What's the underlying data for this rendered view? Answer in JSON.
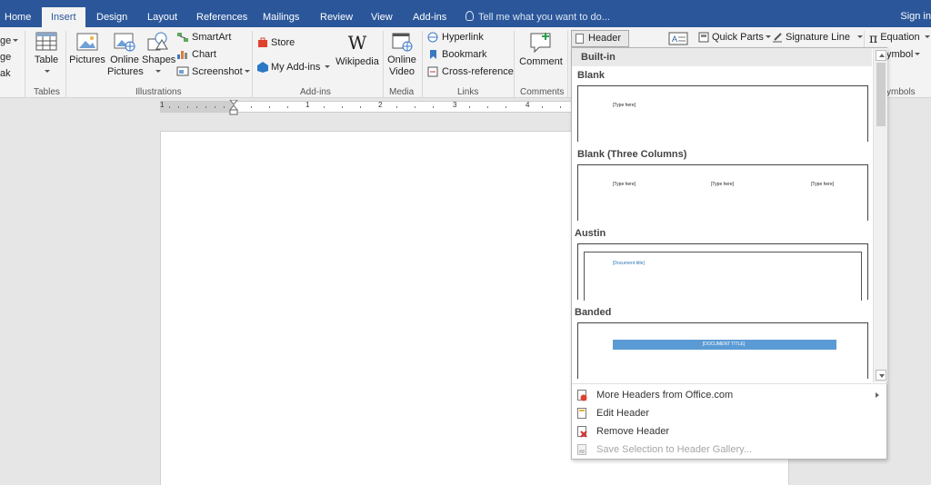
{
  "tabs": [
    {
      "key": "home",
      "label": "Home"
    },
    {
      "key": "insert",
      "label": "Insert",
      "active": true
    },
    {
      "key": "design",
      "label": "Design"
    },
    {
      "key": "layout",
      "label": "Layout"
    },
    {
      "key": "references",
      "label": "References"
    },
    {
      "key": "mailings",
      "label": "Mailings"
    },
    {
      "key": "review",
      "label": "Review"
    },
    {
      "key": "view",
      "label": "View"
    },
    {
      "key": "addins",
      "label": "Add-ins"
    }
  ],
  "tell_me": "Tell me what you want to do...",
  "sign_in": "Sign in",
  "ribbon": {
    "pages_partial": [
      "ge",
      "ge",
      "ak"
    ],
    "table": "Table",
    "tables_group": "Tables",
    "pictures": "Pictures",
    "online_pictures": [
      "Online",
      "Pictures"
    ],
    "shapes": "Shapes",
    "smartart": "SmartArt",
    "chart": "Chart",
    "screenshot": "Screenshot",
    "illustrations_group": "Illustrations",
    "store": "Store",
    "my_addins": "My Add-ins",
    "wikipedia": "Wikipedia",
    "addins_group": "Add-ins",
    "online_video": [
      "Online",
      "Video"
    ],
    "media_group": "Media",
    "hyperlink": "Hyperlink",
    "bookmark": "Bookmark",
    "cross_reference": "Cross-reference",
    "links_group": "Links",
    "comment": "Comment",
    "comments_group": "Comments",
    "header_btn": "Header",
    "quick_parts": "Quick Parts",
    "signature_line": "Signature Line",
    "equation": "Equation",
    "symbol": "ymbol",
    "symbols_group": "ymbols"
  },
  "ruler_numbers": [
    "1",
    "1",
    "2",
    "3",
    "4"
  ],
  "header_gallery": {
    "section_title": "Built-in",
    "items": [
      {
        "name": "Blank",
        "placeholders": [
          "[Type here]"
        ]
      },
      {
        "name": "Blank (Three Columns)",
        "placeholders": [
          "[Type here]",
          "[Type here]",
          "[Type here]"
        ]
      },
      {
        "name": "Austin",
        "placeholders": [
          "[Document title]"
        ]
      },
      {
        "name": "Banded",
        "placeholders": [
          "[DOCUMENT TITLE]"
        ]
      }
    ],
    "banded_color": "#5b9bd5",
    "austin_text_color": "#2e75b6"
  },
  "menu": {
    "more_headers": "More Headers from Office.com",
    "edit_header": "Edit Header",
    "remove_header": "Remove Header",
    "save_selection": "Save Selection to Header Gallery..."
  },
  "colors": {
    "accent": "#2b579a",
    "ribbon_bg": "#f3f3f3"
  }
}
